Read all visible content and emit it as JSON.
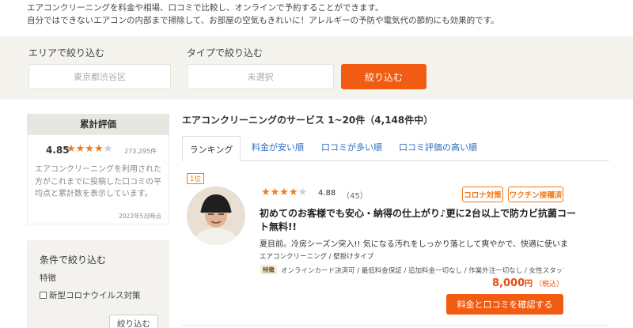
{
  "intro": {
    "line1": "エアコンクリーニングを料金や相場、口コミで比較し、オンラインで予約することができます。",
    "line2": "自分ではできないエアコンの内部まで掃除して、お部屋の空気もきれいに！アレルギーの予防や電気代の節約にも効果的です。"
  },
  "filters": {
    "area_label": "エリアで絞り込む",
    "area_value": "東京都渋谷区",
    "type_label": "タイプで絞り込む",
    "type_value": "未選択",
    "submit": "絞り込む"
  },
  "sidebar": {
    "rating": {
      "title": "累計評価",
      "score": "4.85",
      "stars_on": "★★★★",
      "stars_off": "★",
      "count": "273,295件",
      "description": "エアコンクリーニングを利用された方がこれまでに投稿した口コミの平均点と累計数を表示しています。",
      "date": "2022年5月時点"
    },
    "conditions": {
      "title": "条件で絞り込む",
      "feature_label": "特徴",
      "checkbox_label": "新型コロナウイルス対策",
      "button": "絞り込む"
    }
  },
  "list": {
    "title": "エアコンクリーニングのサービス 1~20件（4,148件中）",
    "tabs": [
      "ランキング",
      "料金が安い順",
      "口コミが多い順",
      "口コミ評価の高い順"
    ]
  },
  "card": {
    "rank": "1位",
    "stars_on": "★★★★",
    "stars_off": "★",
    "score": "4.88",
    "review_count": "（45）",
    "tags": [
      "コロナ対策",
      "ワクチン接種済"
    ],
    "title": "初めてのお客様でも安心・納得の仕上がり♪更に2台以上で防カビ抗菌コート無料!!",
    "description": "夏目前。冷房シーズン突入!! 気になる汚れをしっかり落として爽やかで、快適に使いま…",
    "categories": "エアコンクリーニング / 壁掛けタイプ",
    "feature_badge": "特徴",
    "features": "オンラインカード決済可 / 最低料金保証 / 追加料金一切なし / 作業外注一切なし / 女性スタッフ…",
    "price": "8,000",
    "price_unit": "円",
    "tax": "（税込）",
    "cta": "料金と口コミを確認する"
  },
  "colors": {
    "accent": "#f25c12",
    "star": "#f07a1a",
    "link": "#2b6ec0"
  }
}
